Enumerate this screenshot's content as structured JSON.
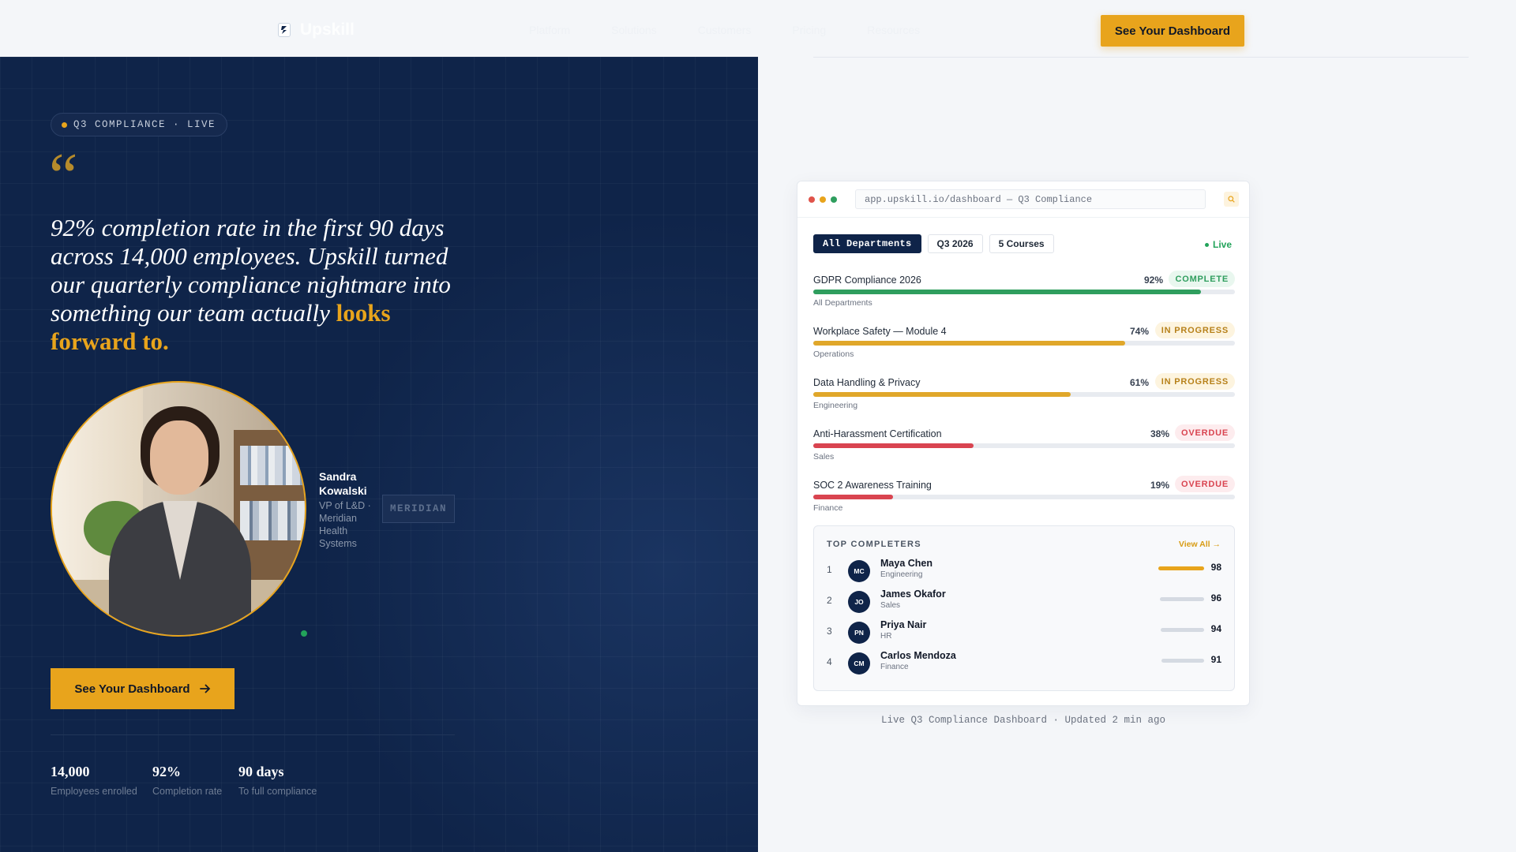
{
  "header": {
    "brand": "Upskill",
    "nav": [
      "Platform",
      "Solutions",
      "Customers",
      "Pricing",
      "Resources"
    ],
    "cta_label": "See Your Dashboard"
  },
  "hero": {
    "pill": "Q3 COMPLIANCE · LIVE",
    "quote_mark": "“",
    "quote": "92% completion rate in the first 90 days across 14,000 employees. Upskill turned our quarterly compliance nightmare into something our team actually ",
    "quote_highlight": "looks forward to.",
    "person": {
      "first_name": "Sandra",
      "last_name": "Kowalski",
      "role": "VP of L&D · Meridian Health Systems"
    },
    "company_logo": "MERIDIAN",
    "cta_label": "See Your Dashboard",
    "stats": [
      {
        "value": "14,000",
        "label": "Employees enrolled"
      },
      {
        "value": "92%",
        "label": "Completion rate"
      },
      {
        "value": "90 days",
        "label": "To full compliance"
      }
    ]
  },
  "dashboard": {
    "url": "app.upskill.io/dashboard — Q3 Compliance",
    "filters": [
      "All Departments",
      "Q3 2026",
      "5 Courses"
    ],
    "live_label": "Live",
    "courses": [
      {
        "title": "GDPR Compliance 2026",
        "pct_label": "92%",
        "progress": 0.92,
        "status": "COMPLETE",
        "dept": "All Departments",
        "color": "#2f9e5e"
      },
      {
        "title": "Workplace Safety — Module 4",
        "pct_label": "74%",
        "progress": 0.74,
        "status": "IN PROGRESS",
        "dept": "Operations",
        "color": "#e0a72a"
      },
      {
        "title": "Data Handling & Privacy",
        "pct_label": "61%",
        "progress": 0.61,
        "status": "IN PROGRESS",
        "dept": "Engineering",
        "color": "#e0a72a"
      },
      {
        "title": "Anti-Harassment Certification",
        "pct_label": "38%",
        "progress": 0.38,
        "status": "OVERDUE",
        "dept": "Sales",
        "color": "#d94450"
      },
      {
        "title": "SOC 2 Awareness Training",
        "pct_label": "19%",
        "progress": 0.19,
        "status": "OVERDUE",
        "dept": "Finance",
        "color": "#d94450"
      }
    ],
    "leaderboard": {
      "title": "TOP COMPLETERS",
      "view_all": "View All →",
      "rows": [
        {
          "rank": "1",
          "initials": "MC",
          "name": "Maya Chen",
          "dept": "Engineering",
          "score": "98"
        },
        {
          "rank": "2",
          "initials": "JO",
          "name": "James Okafor",
          "dept": "Sales",
          "score": "96"
        },
        {
          "rank": "3",
          "initials": "PN",
          "name": "Priya Nair",
          "dept": "HR",
          "score": "94"
        },
        {
          "rank": "4",
          "initials": "CM",
          "name": "Carlos Mendoza",
          "dept": "Finance",
          "score": "91"
        }
      ]
    },
    "caption": "Live Q3 Compliance Dashboard · Updated 2 min ago"
  },
  "colors": {
    "navy": "#0f2449",
    "accent": "#e8a41c",
    "complete": "#2f9e5e",
    "overdue": "#d94450"
  }
}
